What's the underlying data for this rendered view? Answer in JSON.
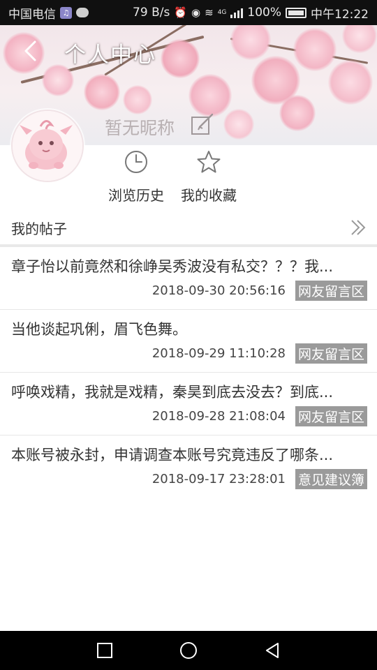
{
  "status_bar": {
    "carrier": "中国电信",
    "net_speed": "79 B/s",
    "signal_label": "4G",
    "battery": "100%",
    "time": "中午12:22"
  },
  "header": {
    "title": "个人中心",
    "nickname": "暂无昵称"
  },
  "actions": [
    {
      "label": "浏览历史",
      "icon": "clock-icon"
    },
    {
      "label": "我的收藏",
      "icon": "star-icon"
    }
  ],
  "posts_section": {
    "title": "我的帖子"
  },
  "posts": [
    {
      "title": "章子怡以前竟然和徐峥吴秀波没有私交？？？我...",
      "time": "2018-09-30 20:56:16",
      "tag": "网友留言区"
    },
    {
      "title": "当他谈起巩俐，眉飞色舞。",
      "time": "2018-09-29 11:10:28",
      "tag": "网友留言区"
    },
    {
      "title": "呼唤戏精，我就是戏精，秦昊到底去没去？到底...",
      "time": "2018-09-28 21:08:04",
      "tag": "网友留言区"
    },
    {
      "title": "本账号被永封，申请调查本账号究竟违反了哪条...",
      "time": "2018-09-17 23:28:01",
      "tag": "意见建议簿"
    }
  ],
  "colors": {
    "tag_bg": "#9a9a9a",
    "status_bar_bg": "#101010",
    "nav_bar_bg": "#000000",
    "blossom_pink": "#f4b9c6"
  }
}
